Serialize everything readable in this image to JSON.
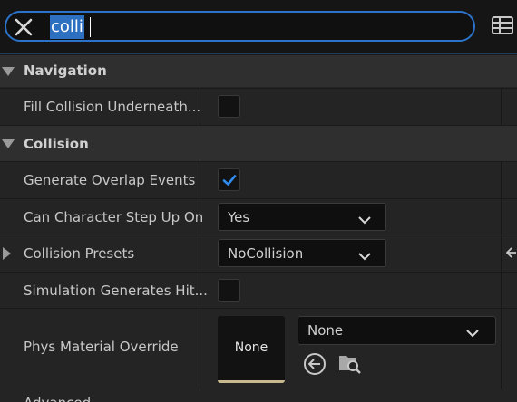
{
  "search": {
    "value": "colli",
    "placeholder": ""
  },
  "categories": [
    {
      "label": "Navigation"
    },
    {
      "label": "Collision"
    }
  ],
  "navigation": {
    "fill_collision_label": "Fill Collision Underneath...",
    "fill_collision_checked": false
  },
  "collision": {
    "generate_overlap_label": "Generate Overlap Events",
    "generate_overlap_checked": true,
    "step_up_label": "Can Character Step Up On",
    "step_up_value": "Yes",
    "presets_label": "Collision Presets",
    "presets_value": "NoCollision",
    "sim_hit_label": "Simulation Generates Hit...",
    "sim_hit_checked": false,
    "phys_material_label": "Phys Material Override",
    "phys_material_thumb": "None",
    "phys_material_value": "None"
  },
  "advanced_label": "Advanced",
  "colors": {
    "accent": "#2b72c9",
    "check": "#2f8cf0",
    "background": "#242424"
  }
}
